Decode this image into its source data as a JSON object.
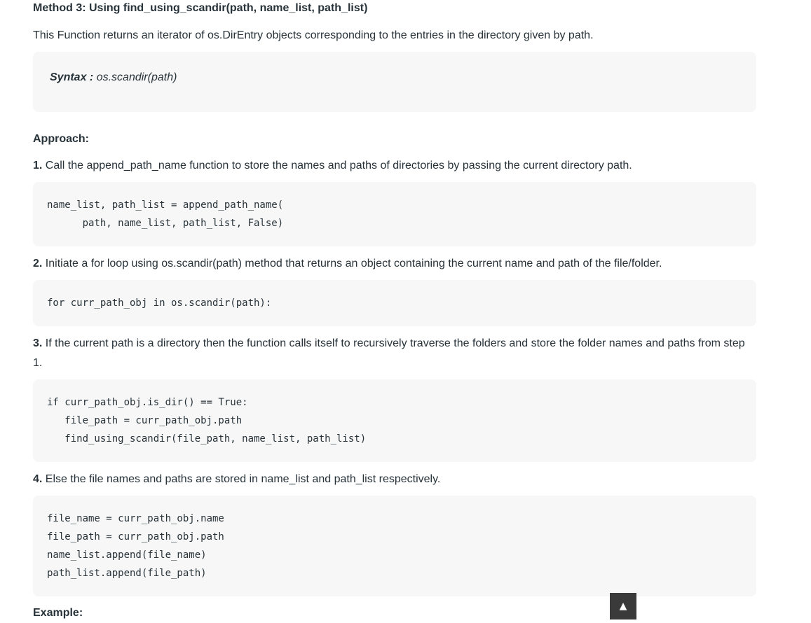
{
  "heading": "Method 3: Using  find_using_scandir(path, name_list, path_list)",
  "intro": "This Function returns an iterator of os.DirEntry objects corresponding to the entries in the directory given by path.",
  "syntax": {
    "label": "Syntax :",
    "value": " os.scandir(path)"
  },
  "approach_label": "Approach:",
  "steps": [
    {
      "num": "1.",
      "text": " Call the append_path_name function to store the names and paths of directories by passing the current directory path.",
      "code": "name_list, path_list = append_path_name(\n      path, name_list, path_list, False)"
    },
    {
      "num": "2.",
      "text": " Initiate a for loop using os.scandir(path) method that returns an object containing the current name and path of the file/folder.",
      "code": "for curr_path_obj in os.scandir(path):"
    },
    {
      "num": "3.",
      "text": " If the current path is a directory then the function calls itself to recursively traverse the folders and store the folder names and paths from step 1.",
      "code": "if curr_path_obj.is_dir() == True:\n   file_path = curr_path_obj.path\n   find_using_scandir(file_path, name_list, path_list)"
    },
    {
      "num": "4.",
      "text": " Else the file names and paths are stored in name_list and path_list respectively.",
      "code": "file_name = curr_path_obj.name\nfile_path = curr_path_obj.path\nname_list.append(file_name)\npath_list.append(file_path)"
    }
  ],
  "example_label": "Example:",
  "scroll_top": {
    "icon": "up-triangle-icon",
    "glyph": "▲"
  }
}
